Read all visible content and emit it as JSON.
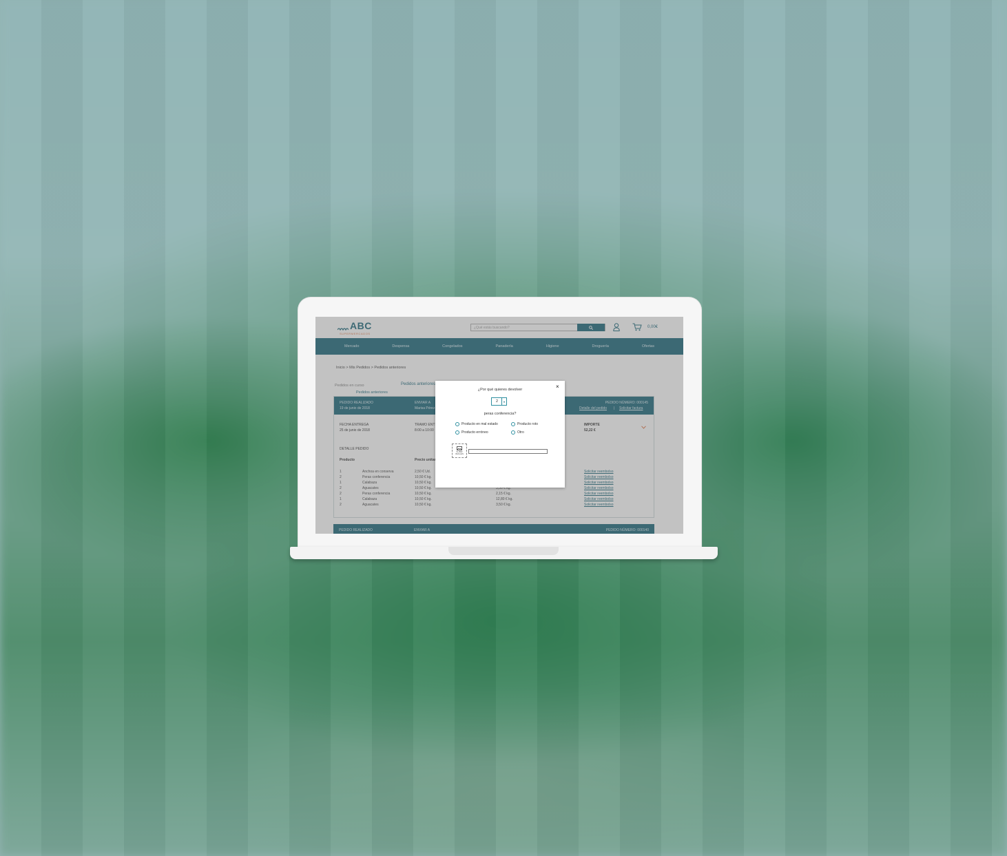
{
  "header": {
    "logo_text": "ABC",
    "logo_subtext": "SUPERMERCADOS",
    "search_placeholder": "¿Qué estás buscando?",
    "cart_total": "0,00€"
  },
  "nav": {
    "items": [
      "Mercado",
      "Despensa",
      "Congelados",
      "Panadería",
      "Higiene",
      "Droguería",
      "Ofertas"
    ]
  },
  "breadcrumb": "Inicio > Mis Pedidos > Pedidos anteriores",
  "subnav": {
    "current": "Pedidos en curso",
    "previous": "Pedidos anteriores",
    "previous_active": "Pedidos anteriores"
  },
  "order": {
    "placed_label": "PEDIDO REALIZADO",
    "placed_date": "19 de junio de 2018",
    "ship_label": "ENVIAR A",
    "ship_name": "Marisa Pérez",
    "number_label": "PEDIDO NÚMERO: 000145",
    "detail_link": "Detalle del pedido",
    "invoice_link": "Solicitar factura",
    "delivery_label": "FECHA ENTREGA",
    "delivery_date": "25 de junio de 2018",
    "slot_label": "TRAMO ENTREGA",
    "slot_value": "8:00 a 10:00",
    "amount_label": "IMPORTE",
    "amount_value": "52,22 €",
    "detail_title": "DETALLE PEDIDO",
    "col_product": "Producto",
    "col_unit_price": "Precio unitario",
    "refund_link": "Solicitar reembolso",
    "rows": [
      {
        "qty": "1",
        "name": "Anchoa en conserva",
        "unit": "2,50 € Ud.",
        "total": ""
      },
      {
        "qty": "2",
        "name": "Peras conferencia",
        "unit": "10,50 € kg.",
        "total": ""
      },
      {
        "qty": "1",
        "name": "Calabaza",
        "unit": "10,50 € kg.",
        "total": ""
      },
      {
        "qty": "2",
        "name": "Aguacates",
        "unit": "10,50 € kg.",
        "total": "3,50 € kg."
      },
      {
        "qty": "2",
        "name": "Peras conferencia",
        "unit": "10,50 € kg.",
        "total": "2,15 € kg."
      },
      {
        "qty": "1",
        "name": "Calabaza",
        "unit": "10,50 € kg.",
        "total": "12,80 € kg."
      },
      {
        "qty": "2",
        "name": "Aguacates",
        "unit": "10,50 € kg.",
        "total": "3,50 € kg."
      }
    ]
  },
  "order2": {
    "placed_label": "PEDIDO REALIZADO",
    "ship_label": "ENVIAR A",
    "number_label": "PEDIDO NÚMERO: 000140"
  },
  "modal": {
    "title": "¿Por qué quieres devolver",
    "quantity": "2",
    "product": "peras conferencia?",
    "options": [
      "Producto en mal estado",
      "Producto roto",
      "Producto erróneo",
      "Otro"
    ],
    "photo_label": "SUBIR IMAGEN",
    "close_symbol": "×"
  },
  "colors": {
    "brand": "#0b5d72",
    "accent": "#e0703d"
  }
}
